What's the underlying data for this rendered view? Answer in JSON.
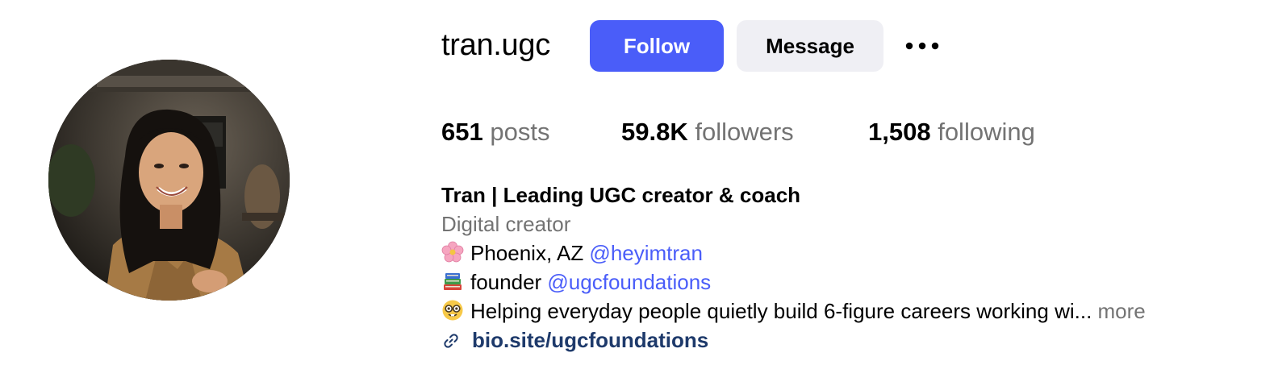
{
  "profile": {
    "username": "tran.ugc",
    "avatar_alt": "profile photo",
    "follow_label": "Follow",
    "message_label": "Message",
    "more_options_icon": "more-horizontal-icon"
  },
  "stats": {
    "posts_count": "651",
    "posts_label": "posts",
    "followers_count": "59.8K",
    "followers_label": "followers",
    "following_count": "1,508",
    "following_label": "following"
  },
  "bio": {
    "full_name": "Tran | Leading UGC creator & coach",
    "category": "Digital creator",
    "line1_text": "Phoenix, AZ ",
    "line1_mention": "@heyimtran",
    "line2_text": "founder ",
    "line2_mention": "@ugcfoundations",
    "line3_text": "Helping everyday people quietly build 6-figure careers working wi...",
    "more_label": " more",
    "link_text": "bio.site/ugcfoundations"
  },
  "colors": {
    "accent": "#4a5df9",
    "secondary_button": "#efeff4",
    "muted_text": "#737373",
    "link_text": "#1e3a6b"
  },
  "icons": {
    "line1": "cherry-blossom-icon",
    "line2": "books-icon",
    "line3": "nerd-face-icon",
    "link": "link-icon"
  }
}
